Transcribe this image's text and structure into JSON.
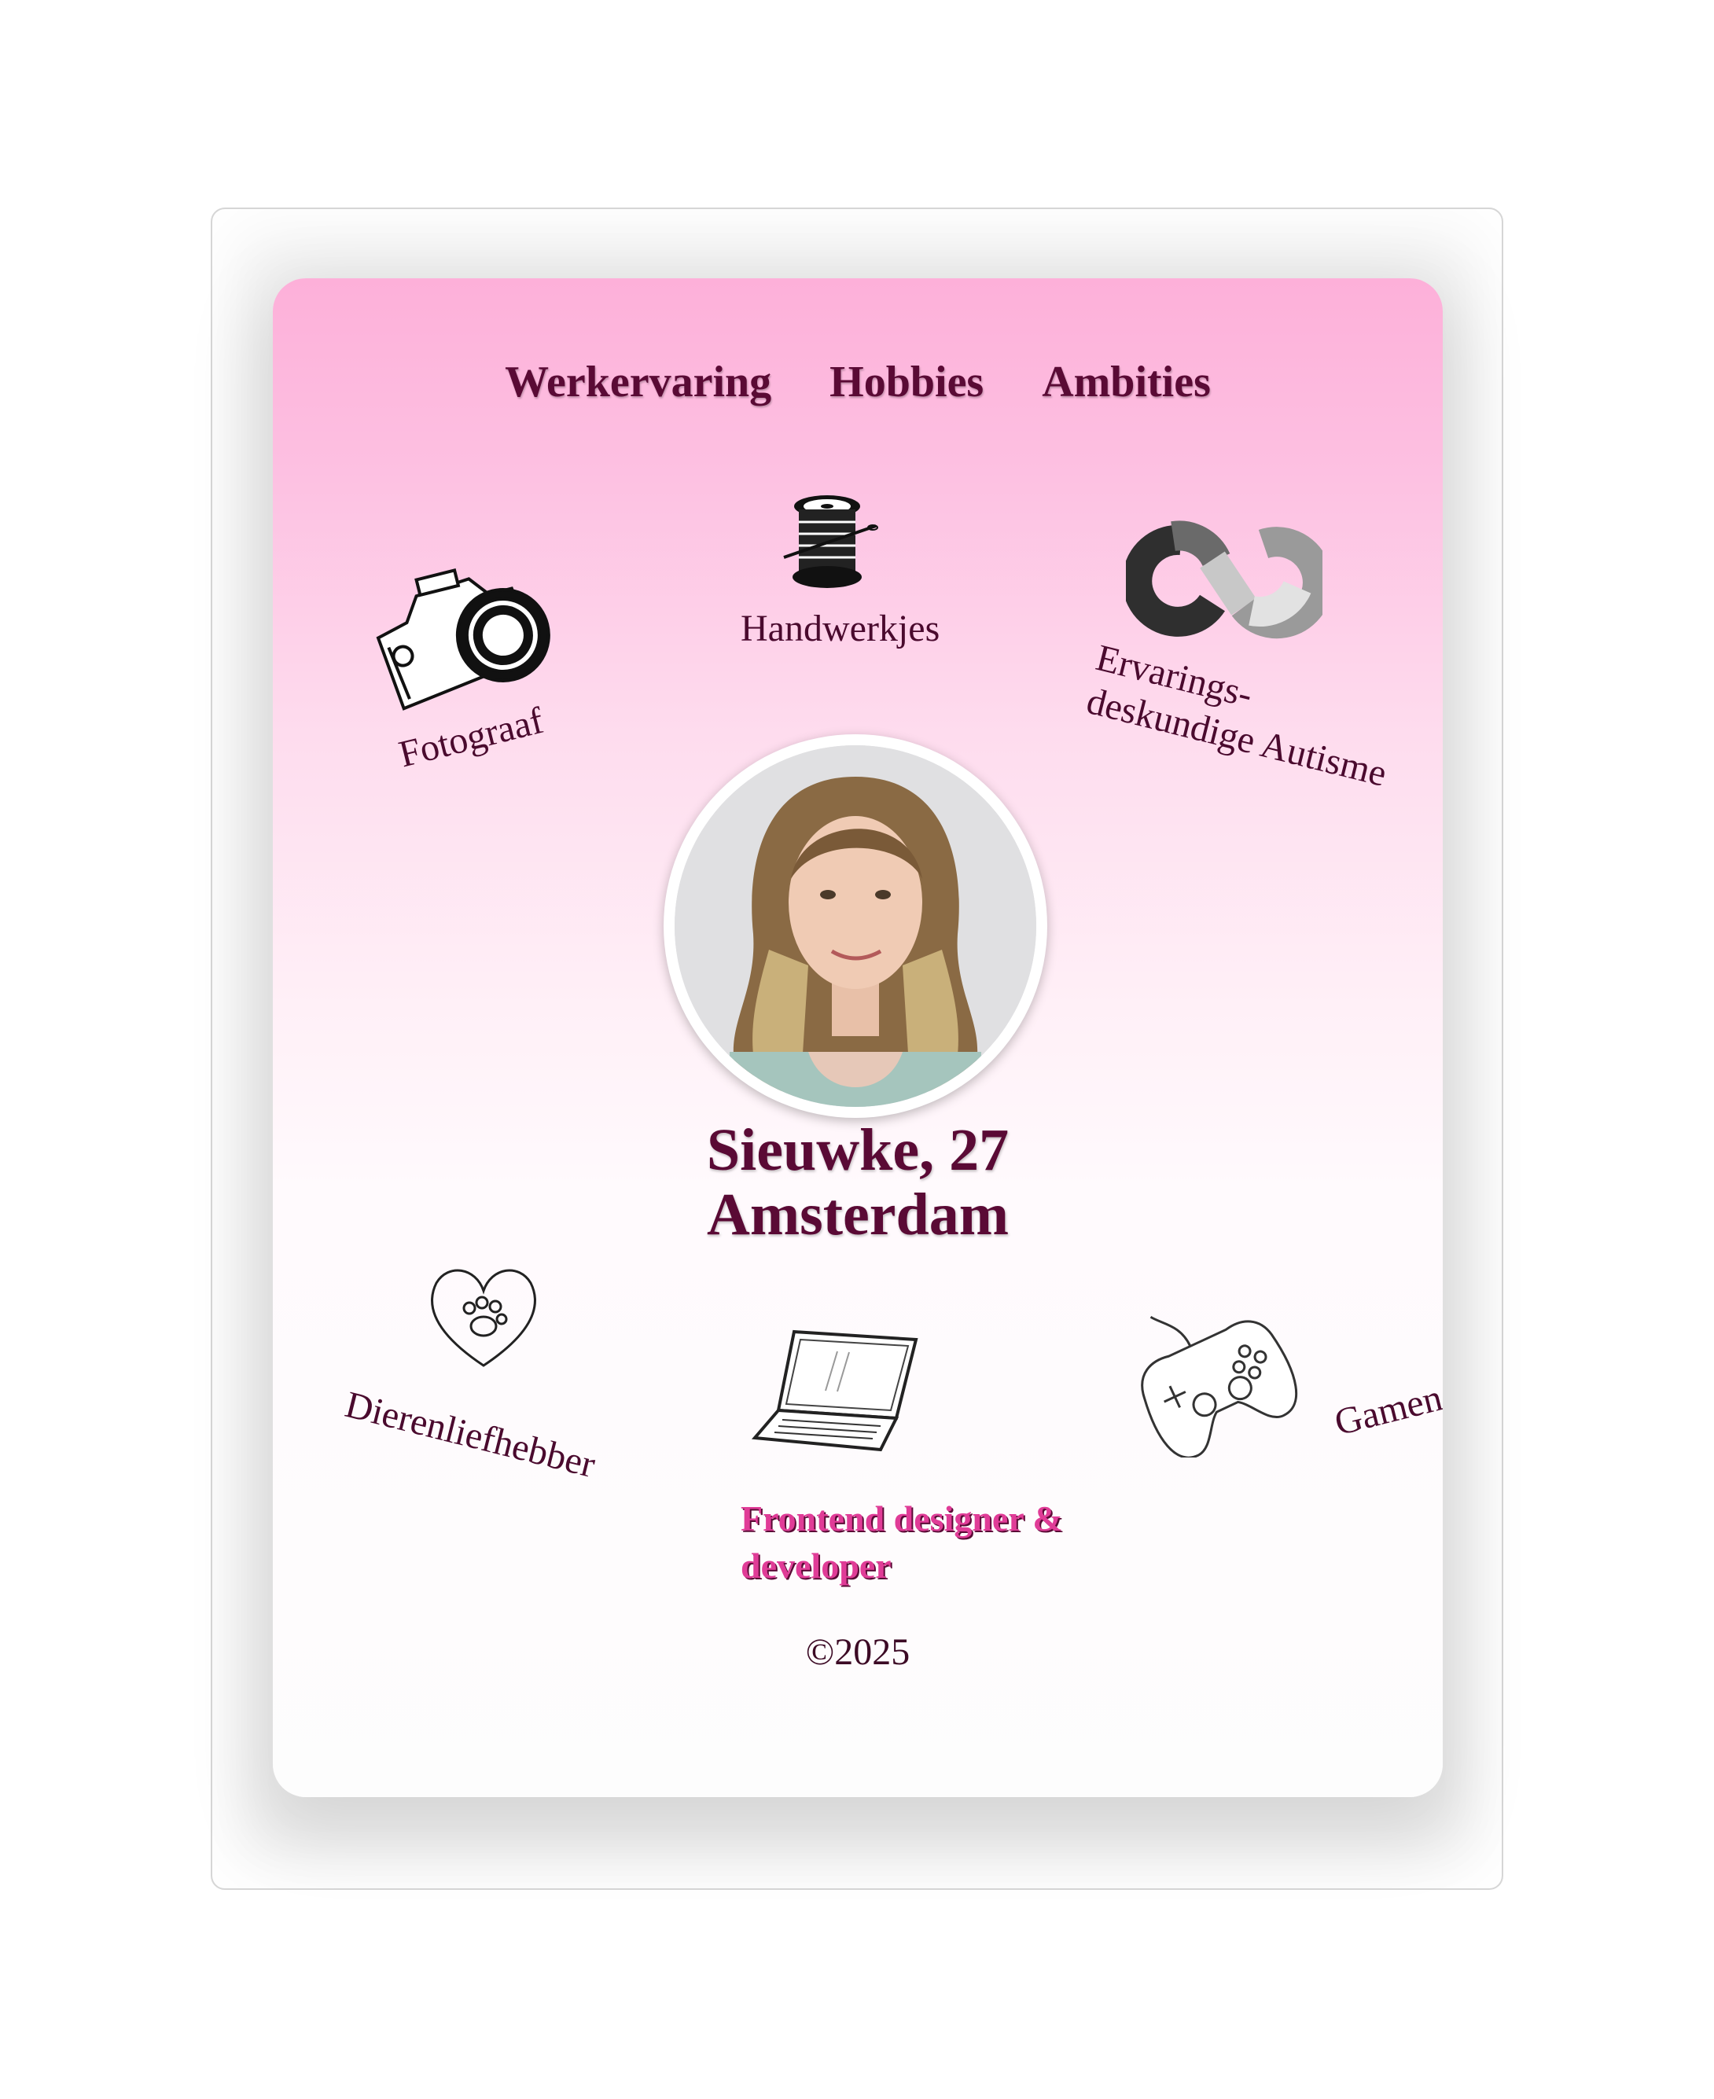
{
  "nav": {
    "items": [
      "Werkervaring",
      "Hobbies",
      "Ambities"
    ]
  },
  "hobbies": {
    "handwerkjes": "Handwerkjes",
    "fotograaf": "Fotograaf",
    "ervarings_line1": "Ervarings-",
    "ervarings_line2": "deskundige Autisme",
    "dierenliefhebber": "Dierenliefhebber",
    "gamen": "Gamen"
  },
  "profile": {
    "name_age": "Sieuwke, 27",
    "city": "Amsterdam"
  },
  "job": {
    "title": "Frontend designer & developer"
  },
  "footer": {
    "copyright": "©2025"
  },
  "icons": {
    "camera": "camera-icon",
    "spool": "thread-spool-icon",
    "infinity": "autism-infinity-icon",
    "heart": "heart-paw-icon",
    "laptop": "laptop-icon",
    "gamepad": "gamepad-icon"
  },
  "colors": {
    "accent": "#5a0a35",
    "pink": "#fdb0d9",
    "job": "#e03c97"
  }
}
